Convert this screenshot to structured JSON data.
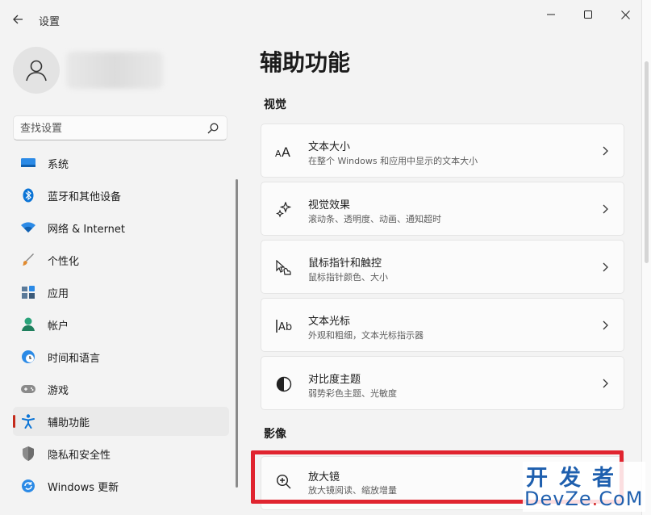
{
  "window": {
    "title": "设置",
    "controls": {
      "minimize": "minimize-icon",
      "maximize": "maximize-icon",
      "close": "close-icon"
    }
  },
  "profile": {
    "avatar_icon": "person-icon"
  },
  "search": {
    "placeholder": "查找设置",
    "icon": "search-icon"
  },
  "sidebar": {
    "items": [
      {
        "label": "系统",
        "icon": "system-display-icon",
        "color": "#0b74d6"
      },
      {
        "label": "蓝牙和其他设备",
        "icon": "bluetooth-icon",
        "color": "#0b74d6"
      },
      {
        "label": "网络 & Internet",
        "icon": "wifi-icon",
        "color": "#0b74d6"
      },
      {
        "label": "个性化",
        "icon": "brush-icon",
        "color": "#d9752b"
      },
      {
        "label": "应用",
        "icon": "apps-icon",
        "color": "#4a6b8a"
      },
      {
        "label": "帐户",
        "icon": "account-icon",
        "color": "#2aa37a"
      },
      {
        "label": "时间和语言",
        "icon": "globe-clock-icon",
        "color": "#0b74d6"
      },
      {
        "label": "游戏",
        "icon": "gamepad-icon",
        "color": "#7a7a7a"
      },
      {
        "label": "辅助功能",
        "icon": "accessibility-icon",
        "color": "#0b74d6",
        "selected": true
      },
      {
        "label": "隐私和安全性",
        "icon": "shield-icon",
        "color": "#7a7a7a"
      },
      {
        "label": "Windows 更新",
        "icon": "windows-update-icon",
        "color": "#0b74d6"
      }
    ]
  },
  "main": {
    "title": "辅助功能",
    "sections": [
      {
        "label": "视觉",
        "cards": [
          {
            "title": "文本大小",
            "subtitle": "在整个 Windows 和应用中显示的文本大小",
            "icon": "text-size-icon"
          },
          {
            "title": "视觉效果",
            "subtitle": "滚动条、透明度、动画、通知超时",
            "icon": "sparkle-icon"
          },
          {
            "title": "鼠标指针和触控",
            "subtitle": "鼠标指针颜色、大小",
            "icon": "pointer-icon"
          },
          {
            "title": "文本光标",
            "subtitle": "外观和粗细，文本光标指示器",
            "icon": "text-cursor-icon"
          },
          {
            "title": "对比度主题",
            "subtitle": "弱势彩色主题、光敏度",
            "icon": "contrast-icon"
          }
        ]
      },
      {
        "label": "影像",
        "cards": [
          {
            "title": "放大镜",
            "subtitle": "放大镜阅读、缩放增量",
            "icon": "zoom-in-icon"
          }
        ]
      }
    ]
  },
  "annotation": {
    "highlight_color": "#e0242f"
  },
  "watermark": {
    "line1": "开发者",
    "line2_a": "DevZe",
    "line2_dot": ".",
    "line2_b": "CoM"
  }
}
